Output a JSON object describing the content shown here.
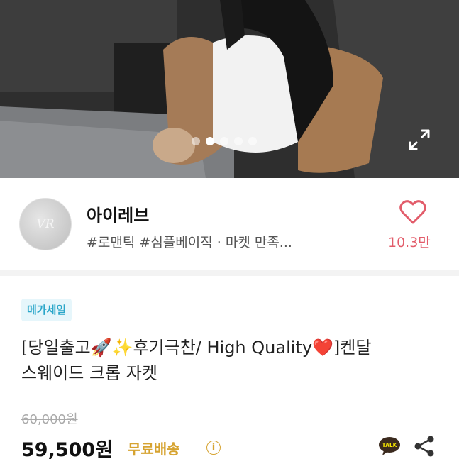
{
  "hero": {
    "slide_count": 5,
    "active_slide": 1,
    "expand_icon": "expand-icon"
  },
  "shop": {
    "avatar_text": "VR",
    "name": "아이레브",
    "tags": "#로맨틱 #심플베이직 · 마켓 만족...",
    "likes": "10.3만",
    "heart_icon": "heart-outline-icon"
  },
  "product": {
    "badge": "메가세일",
    "title_line1": "[당일출고🚀✨후기극찬/ High Quality❤️]켄달",
    "title_line2": "스웨이드 크롭 자켓",
    "original_price": "60,000원",
    "price": "59,500원",
    "shipping": "무료배송",
    "info_icon": "ⓘ"
  },
  "colors": {
    "accent_pink": "#e25c6a",
    "shipping_gold": "#d6a330",
    "badge_blue": "#2aa6c9"
  }
}
